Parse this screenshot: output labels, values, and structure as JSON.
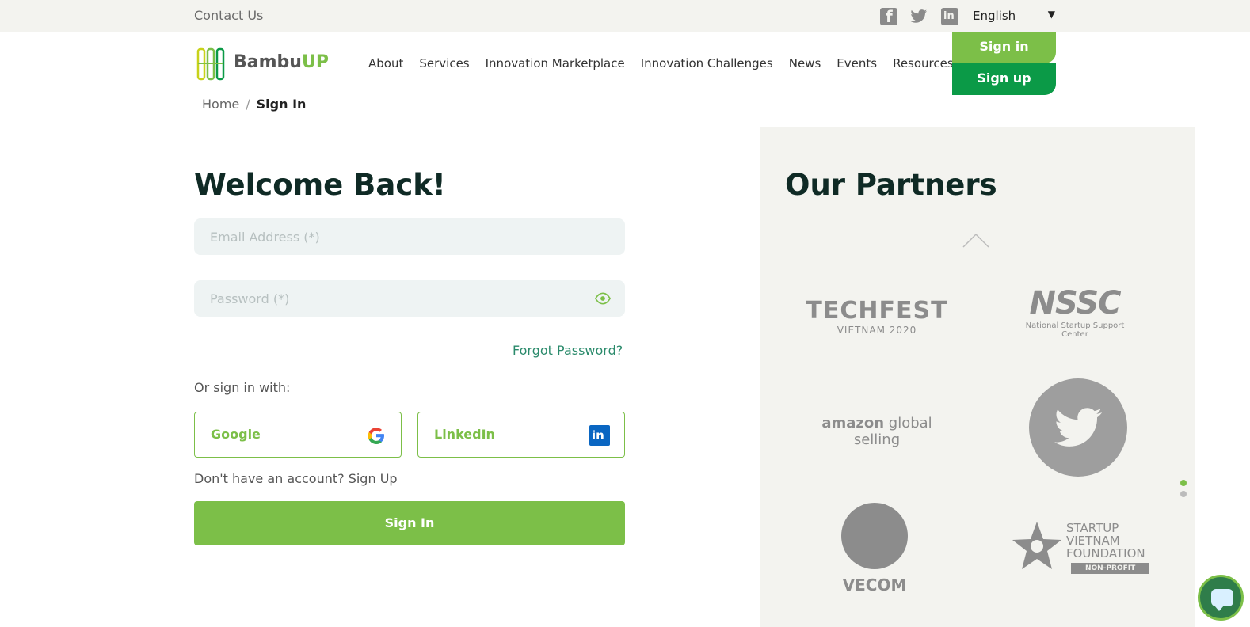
{
  "topbar": {
    "contact_label": "Contact Us",
    "language": "English",
    "icons": [
      "facebook-icon",
      "twitter-icon",
      "linkedin-icon"
    ]
  },
  "header": {
    "logo_prefix": "Bambu",
    "logo_suffix": "UP",
    "nav": [
      "About",
      "Services",
      "Innovation Marketplace",
      "Innovation Challenges",
      "News",
      "Events",
      "Resources"
    ],
    "signin_label": "Sign in",
    "signup_label": "Sign up"
  },
  "breadcrumb": {
    "home": "Home",
    "separator": "/",
    "current": "Sign In"
  },
  "form": {
    "title": "Welcome Back!",
    "email_placeholder": "Email Address (*)",
    "email_value": "",
    "password_placeholder": "Password (*)",
    "password_value": "",
    "forgot_label": "Forgot Password?",
    "or_label": "Or sign in with:",
    "google_label": "Google",
    "linkedin_label": "LinkedIn",
    "no_account_label": "Don't have an account? Sign Up",
    "submit_label": "Sign In"
  },
  "partners": {
    "title": "Our Partners",
    "techfest_line1": "TECHFEST",
    "techfest_line2": "VIETNAM 2020",
    "nssc_line1": "NSSC",
    "nssc_line2": "National Startup Support Center",
    "amazon_brand": "amazon",
    "amazon_rest": " global selling",
    "vecom": "VECOM",
    "svf_line1": "STARTUP",
    "svf_line2": "VIETNAM",
    "svf_line3": "FOUNDATION",
    "svf_badge": "NON-PROFIT"
  },
  "colors": {
    "accent_green": "#7cbf48",
    "dark_green": "#0b9a47",
    "title_dark": "#0f2a25"
  }
}
